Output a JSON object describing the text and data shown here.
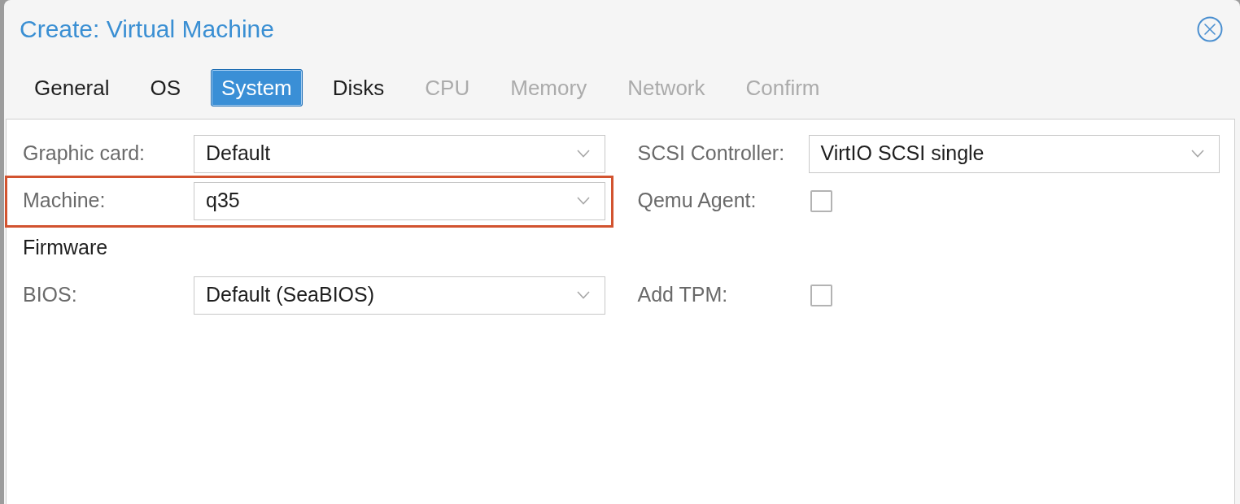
{
  "dialog": {
    "title": "Create: Virtual Machine"
  },
  "tabs": [
    {
      "label": "General",
      "selected": false,
      "disabled": false
    },
    {
      "label": "OS",
      "selected": false,
      "disabled": false
    },
    {
      "label": "System",
      "selected": true,
      "disabled": false
    },
    {
      "label": "Disks",
      "selected": false,
      "disabled": false
    },
    {
      "label": "CPU",
      "selected": false,
      "disabled": true
    },
    {
      "label": "Memory",
      "selected": false,
      "disabled": true
    },
    {
      "label": "Network",
      "selected": false,
      "disabled": true
    },
    {
      "label": "Confirm",
      "selected": false,
      "disabled": true
    }
  ],
  "rows": [
    {
      "left": {
        "kind": "select",
        "label": "Graphic card:",
        "value": "Default",
        "highlighted": false
      },
      "right": {
        "kind": "select",
        "label": "SCSI Controller:",
        "value": "VirtIO SCSI single",
        "highlighted": false
      }
    },
    {
      "left": {
        "kind": "select",
        "label": "Machine:",
        "value": "q35",
        "highlighted": true
      },
      "right": {
        "kind": "checkbox",
        "label": "Qemu Agent:",
        "checked": false,
        "highlighted": false
      }
    },
    {
      "left": {
        "kind": "heading",
        "text": "Firmware",
        "highlighted": false
      }
    },
    {
      "left": {
        "kind": "select",
        "label": "BIOS:",
        "value": "Default (SeaBIOS)",
        "highlighted": false
      },
      "right": {
        "kind": "checkbox",
        "label": "Add TPM:",
        "checked": false,
        "highlighted": false
      }
    }
  ]
}
